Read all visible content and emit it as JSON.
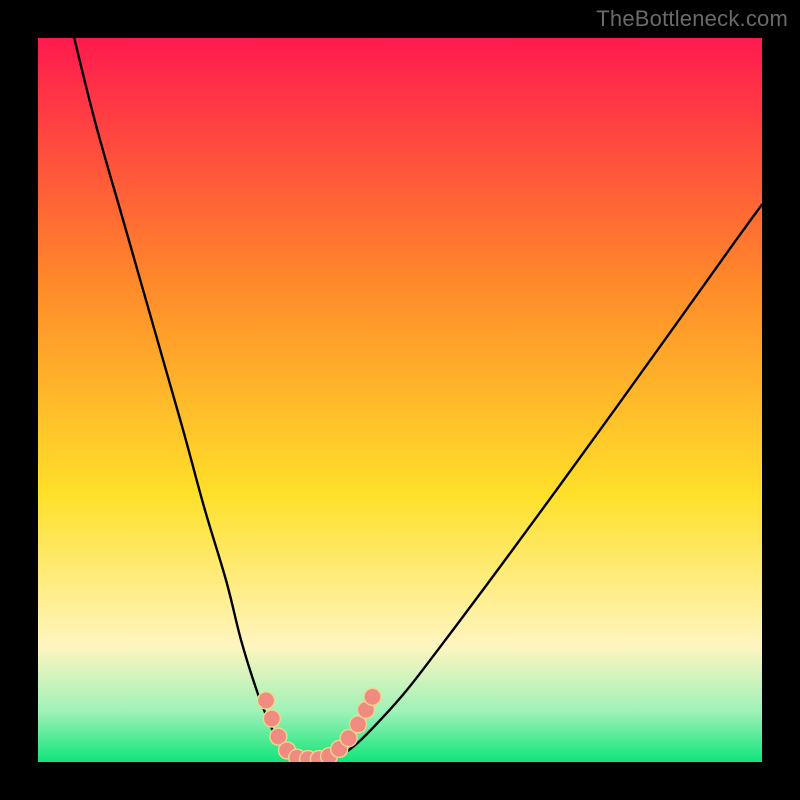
{
  "watermark": "TheBottleneck.com",
  "colors": {
    "gradient_top": "#ff1a4e",
    "gradient_mid1": "#ff8a2a",
    "gradient_mid2": "#ffe02a",
    "gradient_cream": "#fff5c0",
    "gradient_mint": "#9ff2b8",
    "gradient_green": "#10e57a",
    "frame": "#000000",
    "curve": "#000000",
    "marker_fill": "#f08b82",
    "marker_stroke": "#efd68f"
  },
  "chart_data": {
    "type": "line",
    "title": "",
    "xlabel": "",
    "ylabel": "",
    "xlim": [
      0,
      100
    ],
    "ylim": [
      0,
      100
    ],
    "note": "No numeric axis labels are rendered in the image; x/y are normalized 0–100. Curve is a V-shaped bottleneck profile. Values are read from pixel positions.",
    "series": [
      {
        "name": "left-branch",
        "x": [
          5,
          8,
          12,
          16,
          20,
          23,
          26,
          28,
          30,
          31.5,
          33,
          34.5,
          35.5
        ],
        "y": [
          100,
          88,
          74,
          60,
          46,
          35,
          25,
          17,
          10.5,
          6.5,
          3.2,
          1.2,
          0.2
        ]
      },
      {
        "name": "valley",
        "x": [
          35.5,
          36.5,
          37.5,
          38.5,
          39.5,
          40.5
        ],
        "y": [
          0.2,
          0,
          0,
          0,
          0,
          0.2
        ]
      },
      {
        "name": "right-branch",
        "x": [
          40.5,
          42,
          44,
          47,
          51,
          56,
          62,
          69,
          77,
          86,
          96,
          100
        ],
        "y": [
          0.2,
          1.0,
          2.5,
          5.5,
          10,
          16.5,
          24.5,
          34,
          45,
          57.5,
          71.5,
          77
        ]
      }
    ],
    "markers": {
      "name": "bottleneck-dots",
      "points": [
        {
          "x": 31.5,
          "y": 8.5
        },
        {
          "x": 32.3,
          "y": 6.0
        },
        {
          "x": 33.2,
          "y": 3.5
        },
        {
          "x": 34.4,
          "y": 1.6
        },
        {
          "x": 35.8,
          "y": 0.6
        },
        {
          "x": 37.3,
          "y": 0.4
        },
        {
          "x": 38.8,
          "y": 0.4
        },
        {
          "x": 40.2,
          "y": 0.8
        },
        {
          "x": 41.6,
          "y": 1.8
        },
        {
          "x": 42.9,
          "y": 3.3
        },
        {
          "x": 44.2,
          "y": 5.2
        },
        {
          "x": 45.3,
          "y": 7.2
        },
        {
          "x": 46.2,
          "y": 9.0
        }
      ]
    }
  }
}
